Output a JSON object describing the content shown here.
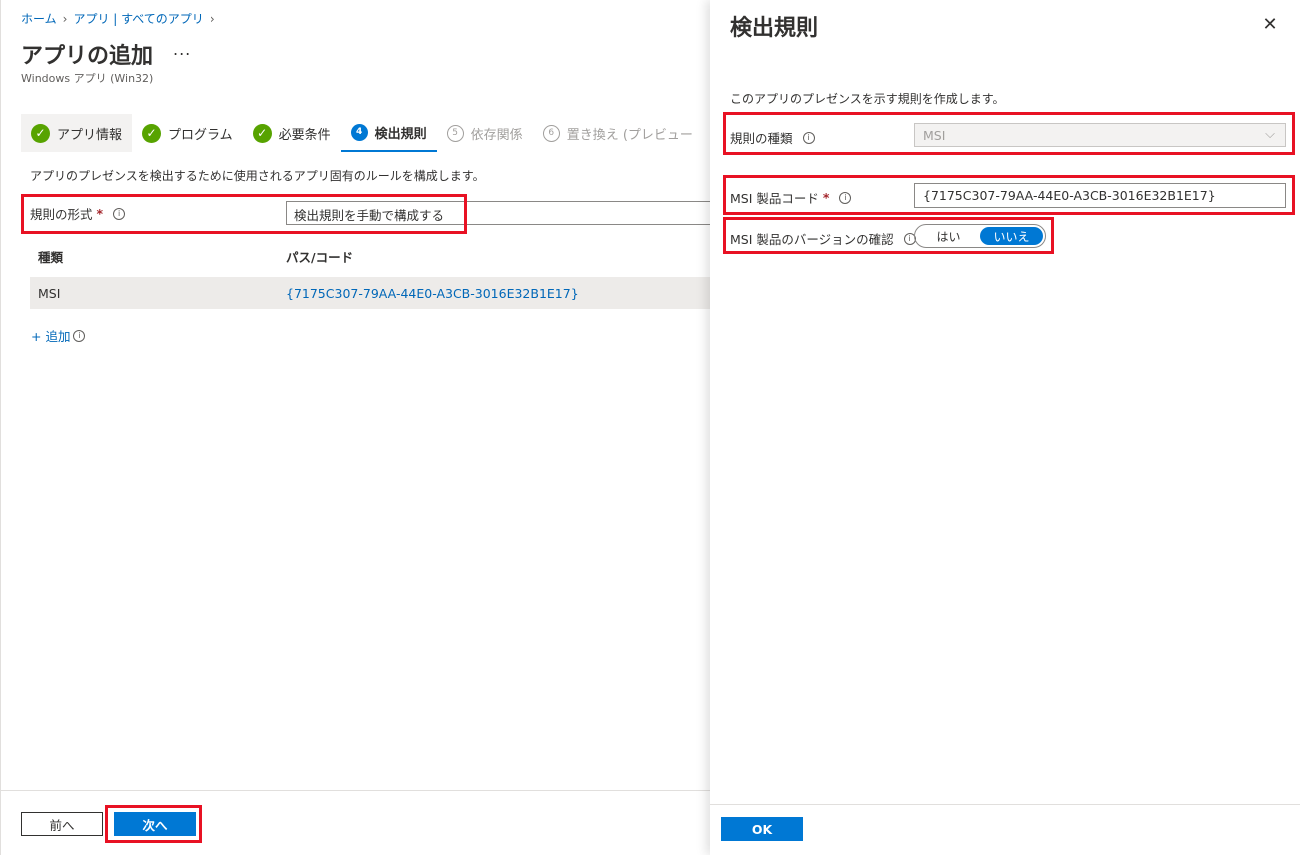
{
  "breadcrumb": {
    "home": "ホーム",
    "apps": "アプリ | すべてのアプリ"
  },
  "page": {
    "title": "アプリの追加",
    "more": "...",
    "subtitle": "Windows アプリ (Win32)"
  },
  "steps": [
    {
      "label": "アプリ情報",
      "state": "done"
    },
    {
      "label": "プログラム",
      "state": "done"
    },
    {
      "label": "必要条件",
      "state": "done"
    },
    {
      "number": "4",
      "label": "検出規則",
      "state": "active"
    },
    {
      "number": "5",
      "label": "依存関係",
      "state": "disabled"
    },
    {
      "number": "6",
      "label": "置き換え (プレビュー",
      "state": "disabled"
    }
  ],
  "main": {
    "description": "アプリのプレゼンスを検出するために使用されるアプリ固有のルールを構成します。",
    "rule_format_label": "規則の形式",
    "required_mark": "*",
    "rule_format_value": "検出規則を手動で構成する",
    "table": {
      "headers": [
        "種類",
        "パス/コード"
      ],
      "rows": [
        {
          "type": "MSI",
          "code": "{7175C307-79AA-44E0-A3CB-3016E32B1E17}"
        }
      ]
    },
    "add_label": "+ 追加"
  },
  "footer": {
    "prev": "前へ",
    "next": "次へ"
  },
  "panel": {
    "title": "検出規則",
    "description": "このアプリのプレゼンスを示す規則を作成します。",
    "rule_type_label": "規則の種類",
    "rule_type_value": "MSI",
    "msi_code_label": "MSI 製品コード",
    "msi_code_value": "{7175C307-79AA-44E0-A3CB-3016E32B1E17}",
    "msi_version_label": "MSI 製品のバージョンの確認",
    "toggle_yes": "はい",
    "toggle_no": "いいえ",
    "toggle_selected": "いいえ",
    "ok": "OK"
  },
  "colors": {
    "accent": "#0078d4",
    "success": "#57a300",
    "highlight": "#e81123"
  }
}
